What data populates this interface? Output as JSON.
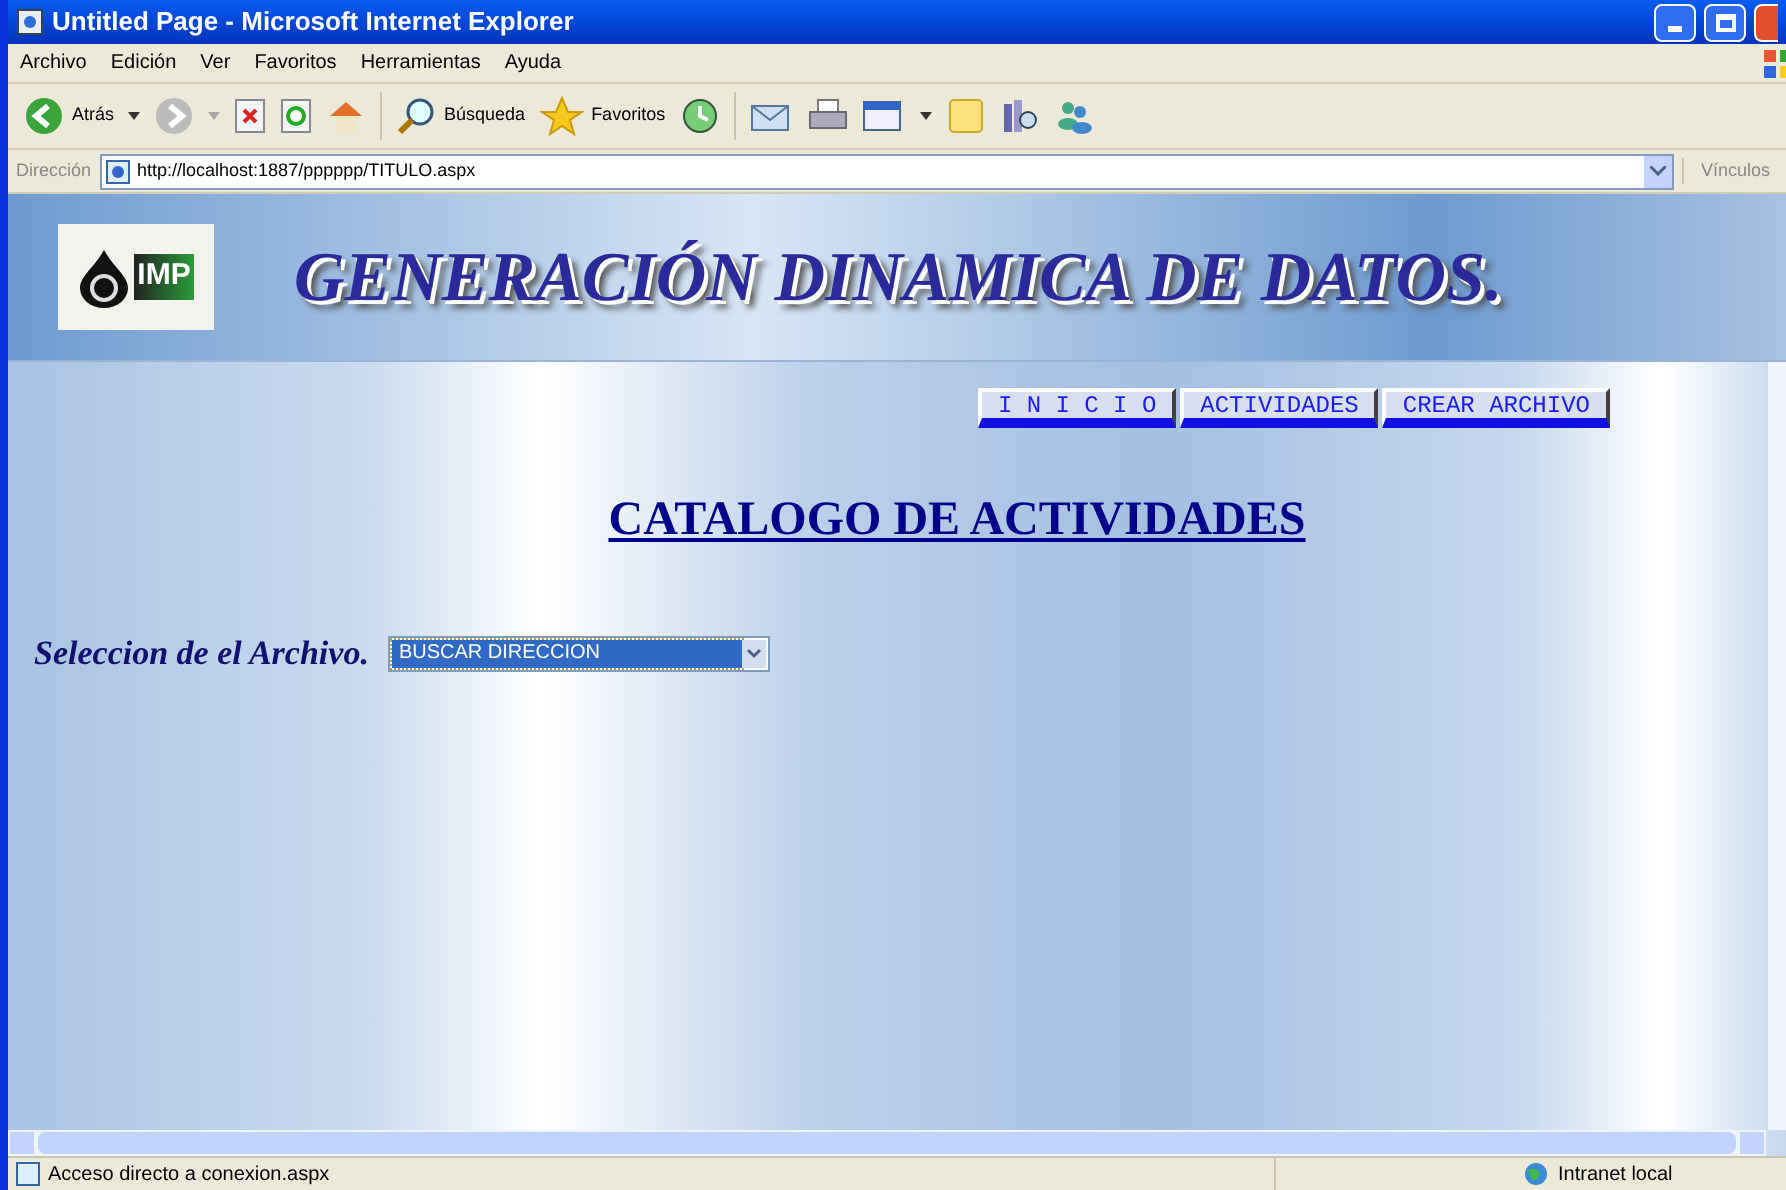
{
  "window": {
    "title": "Untitled Page - Microsoft Internet Explorer"
  },
  "menu": [
    "Archivo",
    "Edición",
    "Ver",
    "Favoritos",
    "Herramientas",
    "Ayuda"
  ],
  "toolbar": {
    "back": "Atrás",
    "search": "Búsqueda",
    "favorites": "Favoritos"
  },
  "address": {
    "label": "Dirección",
    "value": "http://localhost:1887/pppppp/TITULO.aspx",
    "links": "Vínculos"
  },
  "banner": {
    "logo_text": "IMP",
    "title": "GENERACIÓN DINAMICA DE DATOS."
  },
  "nav": [
    "I N I C I O",
    "ACTIVIDADES",
    "CREAR ARCHIVO"
  ],
  "heading": "CATALOGO DE ACTIVIDADES",
  "file_select": {
    "label": "Seleccion de el Archivo.",
    "value": "BUSCAR DIRECCION"
  },
  "status_bar": {
    "text": "Acceso directo a conexion.aspx",
    "zone": "Intranet local"
  }
}
